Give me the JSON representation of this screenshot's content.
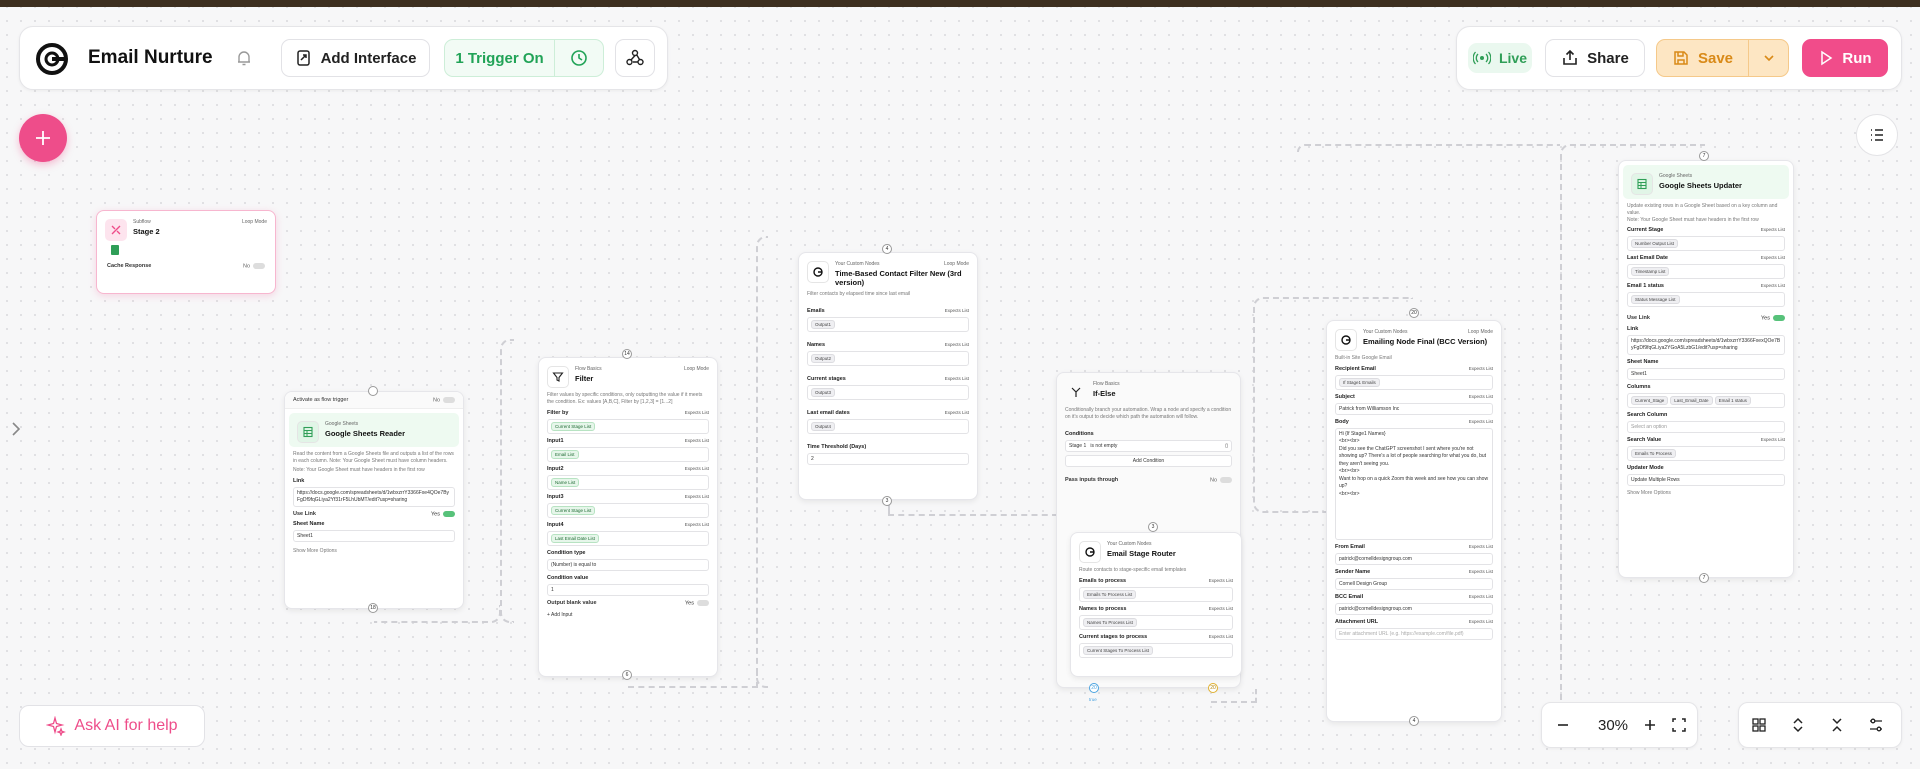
{
  "colors": {
    "accent": "#ee4d8a",
    "live": "#2f9e57",
    "trigger": "#21a357",
    "save_bg": "#fde6c3",
    "run_bg": "#f14c8a"
  },
  "header": {
    "title": "Email Nurture",
    "add_interface": "Add Interface",
    "trigger_status": "1 Trigger On",
    "live": "Live",
    "share": "Share",
    "save": "Save",
    "run": "Run"
  },
  "bottom": {
    "ask_ai": "Ask AI for help",
    "zoom": "30%"
  },
  "nodes": {
    "stage2": {
      "category": "Subflow",
      "loop_mode": "Loop Mode",
      "title": "Stage 2",
      "cache_label": "Cache Response",
      "cache_value": "No"
    },
    "sheets_reader": {
      "activate": "Activate as flow trigger",
      "activate_value": "No",
      "category": "Google Sheets",
      "title": "Google Sheets Reader",
      "desc": "Read the content from a Google Sheets file and outputs a list of the rows in each column. Note: Your Google Sheet must have column headers.",
      "note": "Note: Your Google Sheet must have headers in the first row",
      "link_label": "Link",
      "link_value": "https://docs.google.com/spreadsheets/d/1wbxzrrY3366Fxe4QOe7ByFgDf9fqGLiya2Yf31rF5LhUbMT/edit?usp=sharing",
      "use_link": "Use Link",
      "use_link_value": "Yes",
      "sheet_name": "Sheet Name",
      "sheet_value": "Sheet1",
      "more": "Show More Options",
      "handle": "18"
    },
    "filter": {
      "category": "Flow Basics",
      "loop_mode": "Loop Mode",
      "title": "Filter",
      "desc": "Filter values by specific conditions, only outputting the value if it meets the condition. Ex: values [A,B,C], Filter by [1,2,3] = [1...2]",
      "filter_by": "Filter by",
      "filter_chip": "Current Stage List",
      "input1": "Input1",
      "input1_chip": "Email List",
      "input2": "Input2",
      "input2_chip": "Name List",
      "input3": "Input3",
      "input3_chip": "Current Stage List",
      "input4": "Input4",
      "input4_chip": "Last Email Date List",
      "cond_type": "Condition type",
      "cond_type_value": "(Number) is equal to",
      "cond_value": "Condition value",
      "cond_value_value": "1",
      "blank": "Output blank value",
      "blank_value": "Yes",
      "add_input": "+ Add Input",
      "handle_top": "14",
      "handle_bottom": "6",
      "expects": "Expects List"
    },
    "time_filter": {
      "category": "Your Custom Nodes",
      "loop_mode": "Loop Mode",
      "title": "Time-Based Contact Filter New (3rd version)",
      "desc": "Filter contacts by elapsed time since last email",
      "emails": "Emails",
      "emails_chip": "Output1",
      "names": "Names",
      "names_chip": "Output2",
      "stages": "Current stages",
      "stages_chip": "Output3",
      "dates": "Last email dates",
      "dates_chip": "Output4",
      "threshold": "Time Threshold (Days)",
      "threshold_value": "2",
      "handle_top": "4",
      "handle_bottom": "3",
      "expects": "Expects List"
    },
    "if_else": {
      "category": "Flow Basics",
      "title": "If-Else",
      "desc": "Conditionally branch your automation. Wrap a node and specify a condition on it's output to decide which path the automation will follow.",
      "conditions": "Conditions",
      "cond_left": "Stage 1",
      "cond_op": "is not empty",
      "add_condition": "Add Condition",
      "pass_inputs": "Pass inputs through",
      "pass_value": "No"
    },
    "router": {
      "category": "Your Custom Nodes",
      "title": "Email Stage Router",
      "desc": "Route contacts to stage-specific email templates",
      "emails": "Emails to process",
      "emails_chip": "Emails To Process List",
      "names": "Names to process",
      "names_chip": "Names To Process List",
      "stages": "Current stages to process",
      "stages_chip": "Current Stages To Process List",
      "handle_top": "3",
      "handle_b1": "20",
      "handle_b2": "20",
      "edge_label": "true",
      "expects": "Expects List"
    },
    "emailing": {
      "category": "Your Custom Nodes",
      "loop_mode": "Loop Mode",
      "title": "Emailing Node Final (BCC Version)",
      "desc": "Built-in Site Google Email",
      "recipient": "Recipient Email",
      "recipient_chip": "If Stage1 Emails",
      "subject": "Subject",
      "subject_value": "Patrick from Williamson Inc",
      "body": "Body",
      "body_lines": [
        "Hi {If Stage1 Names}",
        "<br><br>",
        "Did you see the ChatGPT screenshot I sent where you're not showing up? There's a lot of people searching for what you do, but they aren't seeing you.",
        "<br><br>",
        "Want to hop on a quick Zoom this week and see how you can show up?",
        "<br><br>"
      ],
      "from": "From Email",
      "from_value": "patrick@cornelldesigngroup.com",
      "sender": "Sender Name",
      "sender_value": "Cornell Design Group",
      "bcc": "BCC Email",
      "bcc_value": "patrick@cornelldesigngroup.com",
      "attachment": "Attachment URL",
      "attachment_ph": "Enter attachment URL (e.g. https://example.com/file.pdf)",
      "handle_top": "20",
      "handle_bottom": "4",
      "expects": "Expects List"
    },
    "updater": {
      "category": "Google Sheets",
      "title": "Google Sheets Updater",
      "desc": "Update existing rows in a Google Sheet based on a key column and value.",
      "note": "Note: Your Google Sheet must have headers in the first row",
      "stage": "Current Stage",
      "stage_chip": "Number Output List",
      "last_date": "Last Email Date",
      "last_date_chip": "Timestamp List",
      "status": "Email 1 status",
      "status_chip": "Status Message List",
      "use_link": "Use Link",
      "use_link_value": "Yes",
      "link": "Link",
      "link_value": "https://docs.google.com/spreadsheets/d/1wbxzrrY3366FxexQOe7ByFgDf9fqGLiya2YGoA5LzbG1/edit?usp=sharing",
      "sheet_name": "Sheet Name",
      "sheet_value": "Sheet1",
      "columns": "Columns",
      "col1": "Current_Stage",
      "col2": "Last_Email_Date",
      "col3": "Email 1 status",
      "search_col": "Search Column",
      "search_col_ph": "Select an option",
      "search_val": "Search Value",
      "search_val_chip": "Emails To Process",
      "mode": "Updater Mode",
      "mode_value": "Update Multiple Rows",
      "more": "Show More Options",
      "handle_top": "7",
      "handle_bottom": "7",
      "expects": "Expects List"
    }
  }
}
